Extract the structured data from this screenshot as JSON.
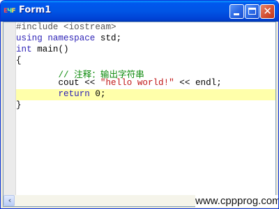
{
  "window": {
    "title": "Form1",
    "icon": "app-icon"
  },
  "editor": {
    "lines": [
      {
        "segments": [
          {
            "t": "#include <iostream>",
            "c": "pre"
          }
        ]
      },
      {
        "segments": [
          {
            "t": "using namespace",
            "c": "kw"
          },
          {
            "t": " std;",
            "c": ""
          }
        ]
      },
      {
        "segments": [
          {
            "t": "int",
            "c": "kw"
          },
          {
            "t": " main()",
            "c": ""
          }
        ]
      },
      {
        "segments": [
          {
            "t": "{",
            "c": ""
          }
        ]
      },
      {
        "segments": [
          {
            "t": "        // 注释：输出字符串",
            "c": "cmt"
          }
        ]
      },
      {
        "segments": [
          {
            "t": "        cout << ",
            "c": ""
          },
          {
            "t": "\"hello world!\"",
            "c": "str"
          },
          {
            "t": " << endl;",
            "c": ""
          }
        ]
      },
      {
        "segments": [
          {
            "t": "        ",
            "c": ""
          },
          {
            "t": "return",
            "c": "kw"
          },
          {
            "t": " 0;",
            "c": ""
          }
        ],
        "highlight": true
      },
      {
        "segments": [
          {
            "t": "}",
            "c": ""
          }
        ]
      }
    ]
  },
  "watermark": "www.cppprog.com",
  "colors": {
    "titlebar": "#0055E5",
    "highlight_line": "#FFFFAA",
    "comment": "#0C8A0C",
    "keyword": "#2A1FB5",
    "string": "#C01515"
  }
}
